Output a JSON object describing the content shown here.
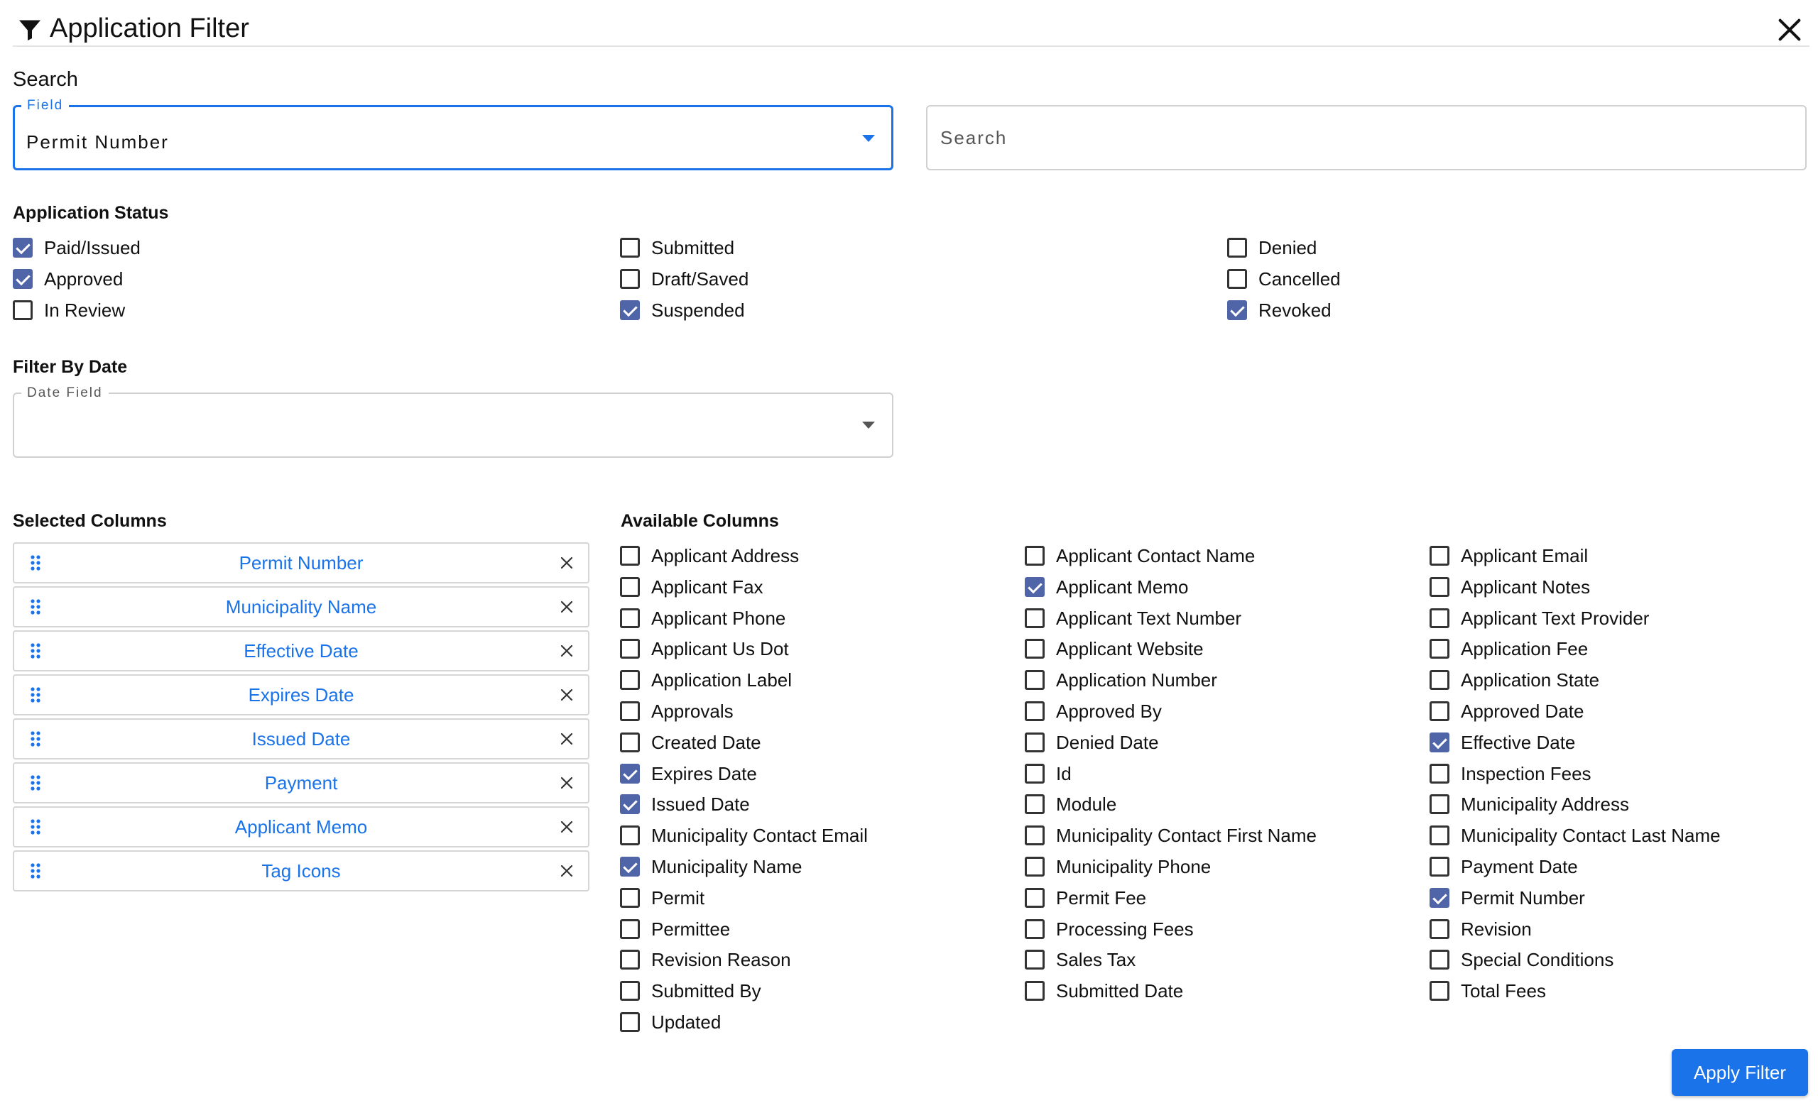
{
  "header": {
    "title": "Application Filter",
    "icon": "filter-icon",
    "close_icon": "close-icon"
  },
  "search": {
    "label": "Search",
    "field_legend": "Field",
    "field_value": "Permit Number",
    "search_placeholder": "Search"
  },
  "status": {
    "label": "Application Status",
    "columns": [
      [
        {
          "label": "Paid/Issued",
          "checked": true
        },
        {
          "label": "Approved",
          "checked": true
        },
        {
          "label": "In Review",
          "checked": false
        }
      ],
      [
        {
          "label": "Submitted",
          "checked": false
        },
        {
          "label": "Draft/Saved",
          "checked": false
        },
        {
          "label": "Suspended",
          "checked": true
        }
      ],
      [
        {
          "label": "Denied",
          "checked": false
        },
        {
          "label": "Cancelled",
          "checked": false
        },
        {
          "label": "Revoked",
          "checked": true
        }
      ]
    ]
  },
  "date_filter": {
    "label": "Filter By Date",
    "legend": "Date Field",
    "value": ""
  },
  "selected_columns": {
    "label": "Selected Columns",
    "items": [
      "Permit Number",
      "Municipality Name",
      "Effective Date",
      "Expires Date",
      "Issued Date",
      "Payment",
      "Applicant Memo",
      "Tag Icons"
    ]
  },
  "available_columns": {
    "label": "Available Columns",
    "columns": [
      [
        {
          "label": "Applicant Address",
          "checked": false
        },
        {
          "label": "Applicant Fax",
          "checked": false
        },
        {
          "label": "Applicant Phone",
          "checked": false
        },
        {
          "label": "Applicant Us Dot",
          "checked": false
        },
        {
          "label": "Application Label",
          "checked": false
        },
        {
          "label": "Approvals",
          "checked": false
        },
        {
          "label": "Created Date",
          "checked": false
        },
        {
          "label": "Expires Date",
          "checked": true
        },
        {
          "label": "Issued Date",
          "checked": true
        },
        {
          "label": "Municipality Contact Email",
          "checked": false
        },
        {
          "label": "Municipality Name",
          "checked": true
        },
        {
          "label": "Permit",
          "checked": false
        },
        {
          "label": "Permittee",
          "checked": false
        },
        {
          "label": "Revision Reason",
          "checked": false
        },
        {
          "label": "Submitted By",
          "checked": false
        },
        {
          "label": "Updated",
          "checked": false
        }
      ],
      [
        {
          "label": "Applicant Contact Name",
          "checked": false
        },
        {
          "label": "Applicant Memo",
          "checked": true
        },
        {
          "label": "Applicant Text Number",
          "checked": false
        },
        {
          "label": "Applicant Website",
          "checked": false
        },
        {
          "label": "Application Number",
          "checked": false
        },
        {
          "label": "Approved By",
          "checked": false
        },
        {
          "label": "Denied Date",
          "checked": false
        },
        {
          "label": "Id",
          "checked": false
        },
        {
          "label": "Module",
          "checked": false
        },
        {
          "label": "Municipality Contact First Name",
          "checked": false
        },
        {
          "label": "Municipality Phone",
          "checked": false
        },
        {
          "label": "Permit Fee",
          "checked": false
        },
        {
          "label": "Processing Fees",
          "checked": false
        },
        {
          "label": "Sales Tax",
          "checked": false
        },
        {
          "label": "Submitted Date",
          "checked": false
        }
      ],
      [
        {
          "label": "Applicant Email",
          "checked": false
        },
        {
          "label": "Applicant Notes",
          "checked": false
        },
        {
          "label": "Applicant Text Provider",
          "checked": false
        },
        {
          "label": "Application Fee",
          "checked": false
        },
        {
          "label": "Application State",
          "checked": false
        },
        {
          "label": "Approved Date",
          "checked": false
        },
        {
          "label": "Effective Date",
          "checked": true
        },
        {
          "label": "Inspection Fees",
          "checked": false
        },
        {
          "label": "Municipality Address",
          "checked": false
        },
        {
          "label": "Municipality Contact Last Name",
          "checked": false
        },
        {
          "label": "Payment Date",
          "checked": false
        },
        {
          "label": "Permit Number",
          "checked": true
        },
        {
          "label": "Revision",
          "checked": false
        },
        {
          "label": "Special Conditions",
          "checked": false
        },
        {
          "label": "Total Fees",
          "checked": false
        }
      ]
    ]
  },
  "actions": {
    "apply_label": "Apply Filter"
  },
  "colors": {
    "accent": "#1a73e8",
    "checkbox_checked": "#5065a8",
    "border": "#d0d0d0"
  }
}
